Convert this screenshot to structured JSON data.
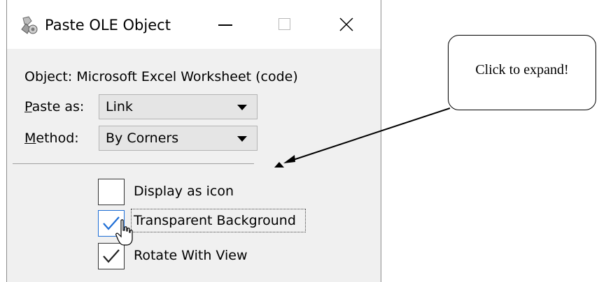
{
  "window": {
    "title": "Paste OLE Object",
    "icon": "paste-ole-icon"
  },
  "object": {
    "label_prefix": "Object: ",
    "value": "Microsoft Excel Worksheet (code)"
  },
  "paste_as": {
    "label_mnemonic": "P",
    "label_rest": "aste as:",
    "selected": "Link"
  },
  "method": {
    "label_mnemonic": "M",
    "label_rest": "ethod:",
    "selected": "By Corners"
  },
  "options": {
    "display_as_icon": {
      "label": "Display as icon",
      "checked": false
    },
    "transparent_background": {
      "label": "Transparent Background",
      "checked": true
    },
    "rotate_with_view": {
      "label": "Rotate With View",
      "checked": true
    }
  },
  "callout": {
    "text": "Click to expand!"
  },
  "colors": {
    "dialog_bg": "#f0f0f0",
    "focus_blue": "#1e6ed6",
    "check_blue": "#1e6ed6"
  }
}
